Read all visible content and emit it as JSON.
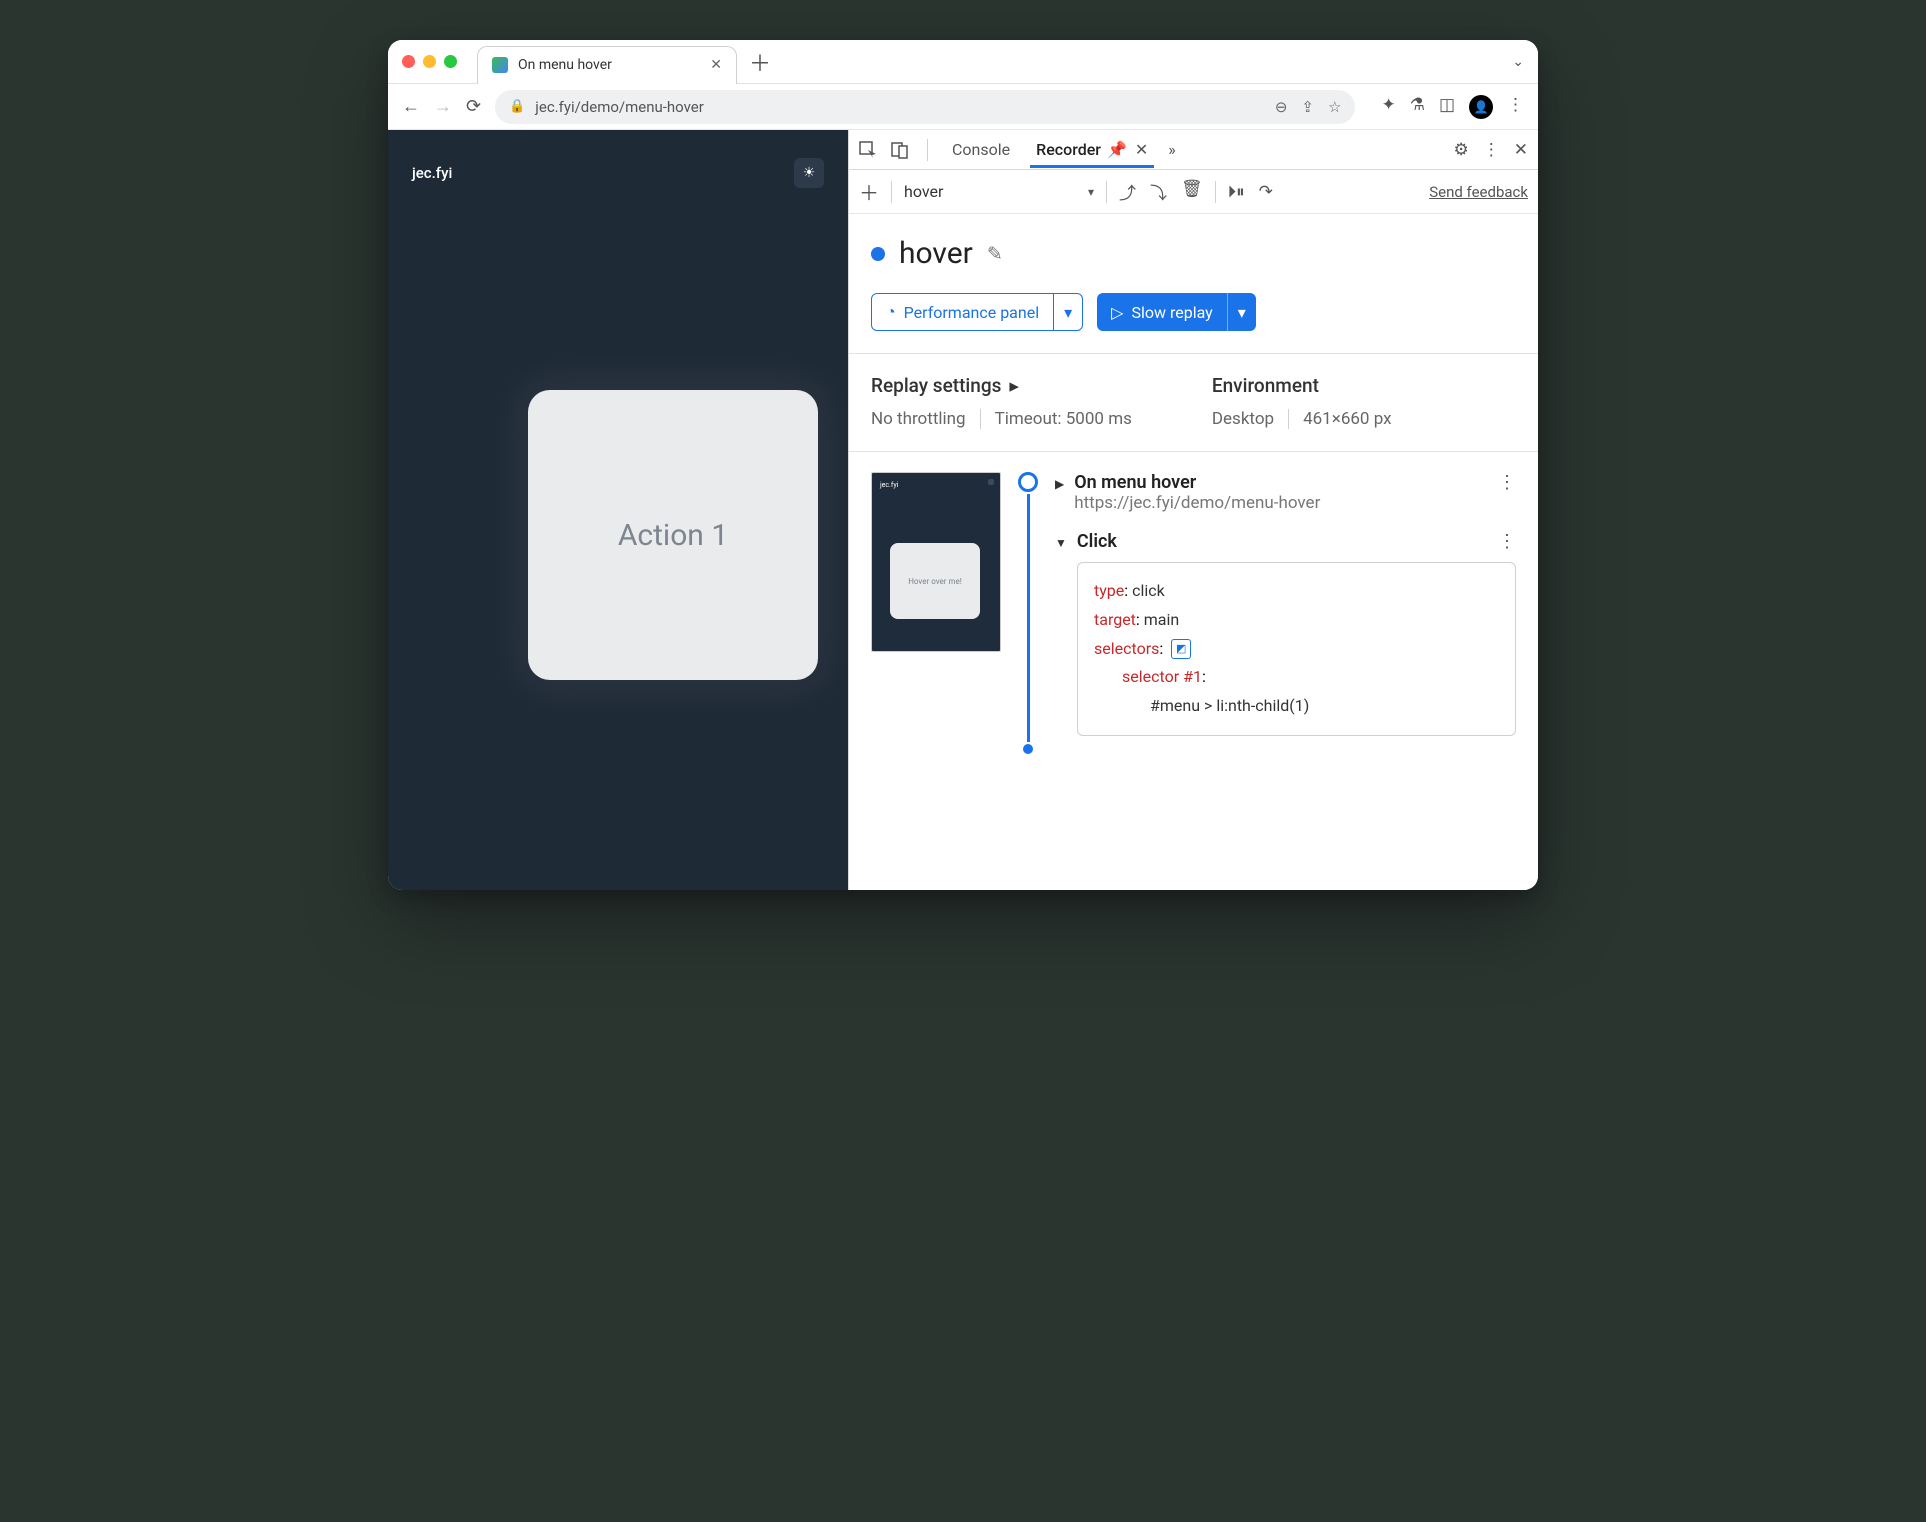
{
  "chrome": {
    "tab_title": "On menu hover",
    "url": "jec.fyi/demo/menu-hover"
  },
  "page": {
    "brand": "jec.fyi",
    "card_text": "Action 1"
  },
  "devtools": {
    "tabs": {
      "console": "Console",
      "recorder": "Recorder"
    },
    "recorder": {
      "select_value": "hover",
      "feedback": "Send feedback",
      "flow_name": "hover",
      "perf_btn": "Performance panel",
      "replay_btn": "Slow replay",
      "settings": {
        "replay_label": "Replay settings",
        "throttling": "No throttling",
        "timeout": "Timeout: 5000 ms",
        "env_label": "Environment",
        "env_device": "Desktop",
        "env_size": "461×660 px"
      },
      "thumb_text": "Hover over me!",
      "steps": {
        "nav": {
          "title": "On menu hover",
          "url": "https://jec.fyi/demo/menu-hover"
        },
        "click": {
          "label": "Click",
          "type_k": "type",
          "type_v": "click",
          "target_k": "target",
          "target_v": "main",
          "selectors_k": "selectors",
          "selector_label": "selector #1",
          "selector_code": "#menu > li:nth-child(1)"
        }
      }
    }
  }
}
